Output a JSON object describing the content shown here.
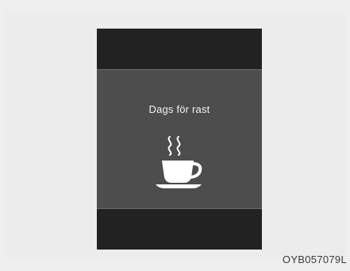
{
  "display": {
    "message": "Dags för rast",
    "icon": "coffee-cup-icon"
  },
  "figure": {
    "reference_code": "OYB057079L"
  },
  "colors": {
    "background": "#efefef",
    "display_band": "#222222",
    "display_panel": "#4d4d4d",
    "text": "#f2f2f2"
  }
}
